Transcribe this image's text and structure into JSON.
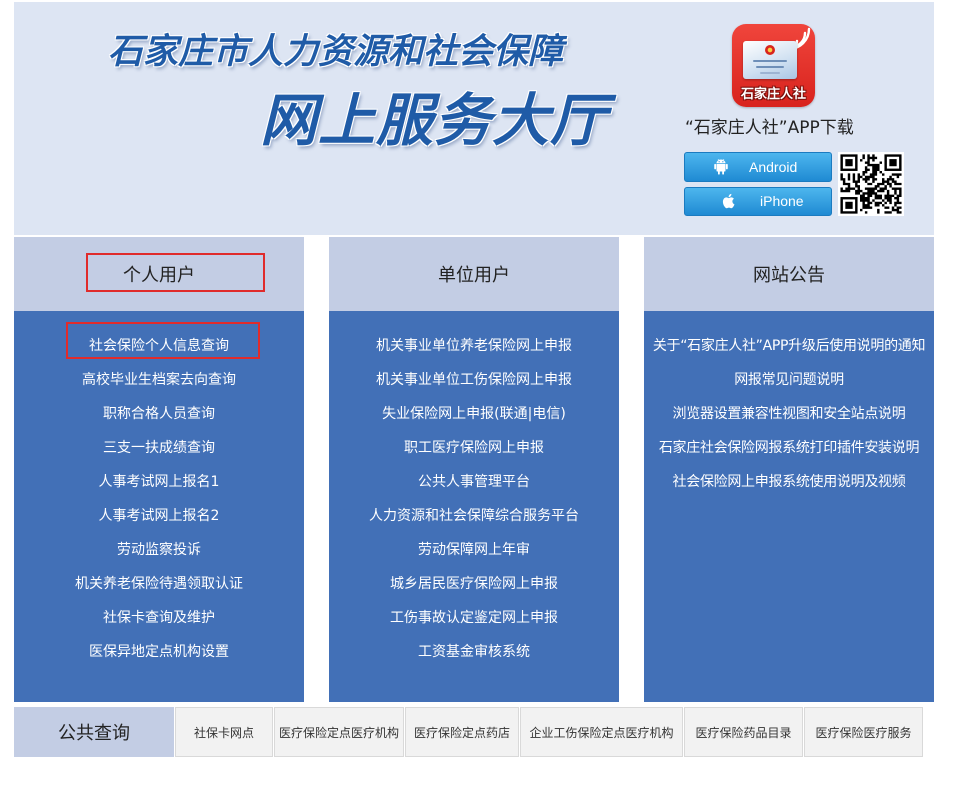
{
  "header": {
    "title_line1": "石家庄市人力资源和社会保障",
    "title_line2": "网上服务大厅",
    "app_icon_text": "石家庄人社",
    "app_download_text": "“石家庄人社”APP下载",
    "android_button_label": "Android",
    "iphone_button_label": "iPhone"
  },
  "columns": [
    {
      "title": "个人用户",
      "items": [
        "社会保险个人信息查询",
        "高校毕业生档案去向查询",
        "职称合格人员查询",
        "三支一扶成绩查询",
        "人事考试网上报名1",
        "人事考试网上报名2",
        "劳动监察投诉",
        "机关养老保险待遇领取认证",
        "社保卡查询及维护",
        "医保异地定点机构设置"
      ]
    },
    {
      "title": "单位用户",
      "items": [
        "机关事业单位养老保险网上申报",
        "机关事业单位工伤保险网上申报",
        "失业保险网上申报(联通|电信)",
        "职工医疗保险网上申报",
        "公共人事管理平台",
        "人力资源和社会保障综合服务平台",
        "劳动保障网上年审",
        "城乡居民医疗保险网上申报",
        "工伤事故认定鉴定网上申报",
        "工资基金审核系统"
      ]
    },
    {
      "title": "网站公告",
      "items": [
        "关于“石家庄人社”APP升级后使用说明的通知",
        "网报常见问题说明",
        "浏览器设置兼容性视图和安全站点说明",
        "石家庄社会保险网报系统打印插件安装说明",
        "社会保险网上申报系统使用说明及视频"
      ]
    }
  ],
  "public_query": {
    "label": "公共查询",
    "tabs": [
      "社保卡网点",
      "医疗保险定点医疗机构",
      "医疗保险定点药店",
      "企业工伤保险定点医疗机构",
      "医疗保险药品目录",
      "医疗保险医疗服务"
    ]
  },
  "icons": {
    "app_logo": "app-logo-icon",
    "app_signal": "nfc-signal-icon",
    "app_card": "social-security-card-icon",
    "android": "android-icon",
    "iphone": "apple-icon",
    "qr": "qr-code-icon"
  },
  "colors": {
    "header_background": "#dde5f3",
    "title_blue": "#1f5ba7",
    "column_header_background": "#c3cde4",
    "column_body_background": "#4270b7",
    "app_icon_red": "#e52d27",
    "download_button_blue": "#2a95dc",
    "highlight_red": "#e02b2b",
    "tab_background": "#f2f2f2"
  }
}
